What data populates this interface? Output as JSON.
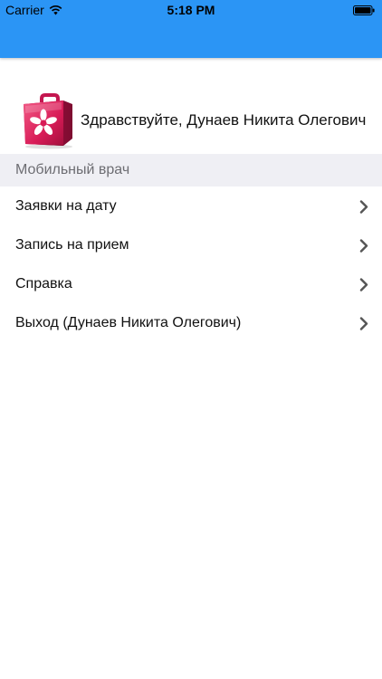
{
  "status_bar": {
    "carrier": "Carrier",
    "time": "5:18 PM",
    "wifi_icon": "wifi-icon",
    "battery_icon": "battery-icon"
  },
  "colors": {
    "nav_bar": "#2b95f5",
    "section_bg": "#efeff4",
    "section_text": "#6d6d72",
    "chevron": "#555555"
  },
  "greeting": {
    "logo_icon": "medical-kit-icon",
    "text": "Здравствуйте, Дунаев Никита Олегович"
  },
  "section": {
    "title": "Мобильный врач"
  },
  "menu": {
    "items": [
      {
        "label": "Заявки на дату",
        "icon": "chevron-right-icon"
      },
      {
        "label": "Запись на прием",
        "icon": "chevron-right-icon"
      },
      {
        "label": "Справка",
        "icon": "chevron-right-icon"
      },
      {
        "label": "Выход (Дунаев Никита Олегович)",
        "icon": "chevron-right-icon"
      }
    ]
  }
}
